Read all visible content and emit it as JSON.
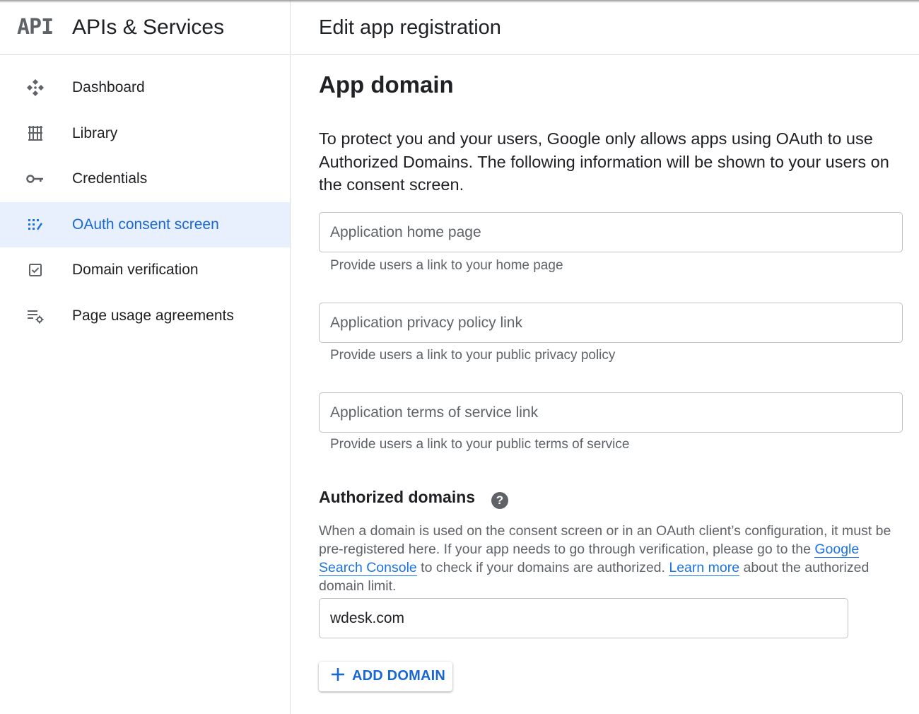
{
  "sidebar": {
    "logo": "API",
    "title": "APIs & Services",
    "items": [
      {
        "label": "Dashboard",
        "icon": "dashboard-icon",
        "active": false
      },
      {
        "label": "Library",
        "icon": "library-icon",
        "active": false
      },
      {
        "label": "Credentials",
        "icon": "key-icon",
        "active": false
      },
      {
        "label": "OAuth consent screen",
        "icon": "consent-icon",
        "active": true
      },
      {
        "label": "Domain verification",
        "icon": "checkbox-icon",
        "active": false
      },
      {
        "label": "Page usage agreements",
        "icon": "settings-list-icon",
        "active": false
      }
    ]
  },
  "header": {
    "title": "Edit app registration"
  },
  "app_domain": {
    "title": "App domain",
    "intro": "To protect you and your users, Google only allows apps using OAuth to use Authorized Domains. The following information will be shown to your users on the consent screen.",
    "home_page": {
      "placeholder": "Application home page",
      "value": "",
      "hint": "Provide users a link to your home page"
    },
    "privacy": {
      "placeholder": "Application privacy policy link",
      "value": "",
      "hint": "Provide users a link to your public privacy policy"
    },
    "terms": {
      "placeholder": "Application terms of service link",
      "value": "",
      "hint": "Provide users a link to your public terms of service"
    }
  },
  "authorized_domains": {
    "title": "Authorized domains",
    "help_icon": "help-icon",
    "desc_part1": "When a domain is used on the consent screen or in an OAuth client’s configuration, it must be pre-registered here. If your app needs to go through verification, please go to the ",
    "link_search_console": "Google Search Console",
    "desc_part2": " to check if your domains are authorized. ",
    "link_learn_more": "Learn more",
    "desc_part3": " about the authorized domain limit.",
    "domain_value": "wdesk.com",
    "add_button": "ADD DOMAIN"
  },
  "colors": {
    "accent": "#1a73e8",
    "active_bg": "#e8f0fe",
    "border": "#dadce0"
  }
}
